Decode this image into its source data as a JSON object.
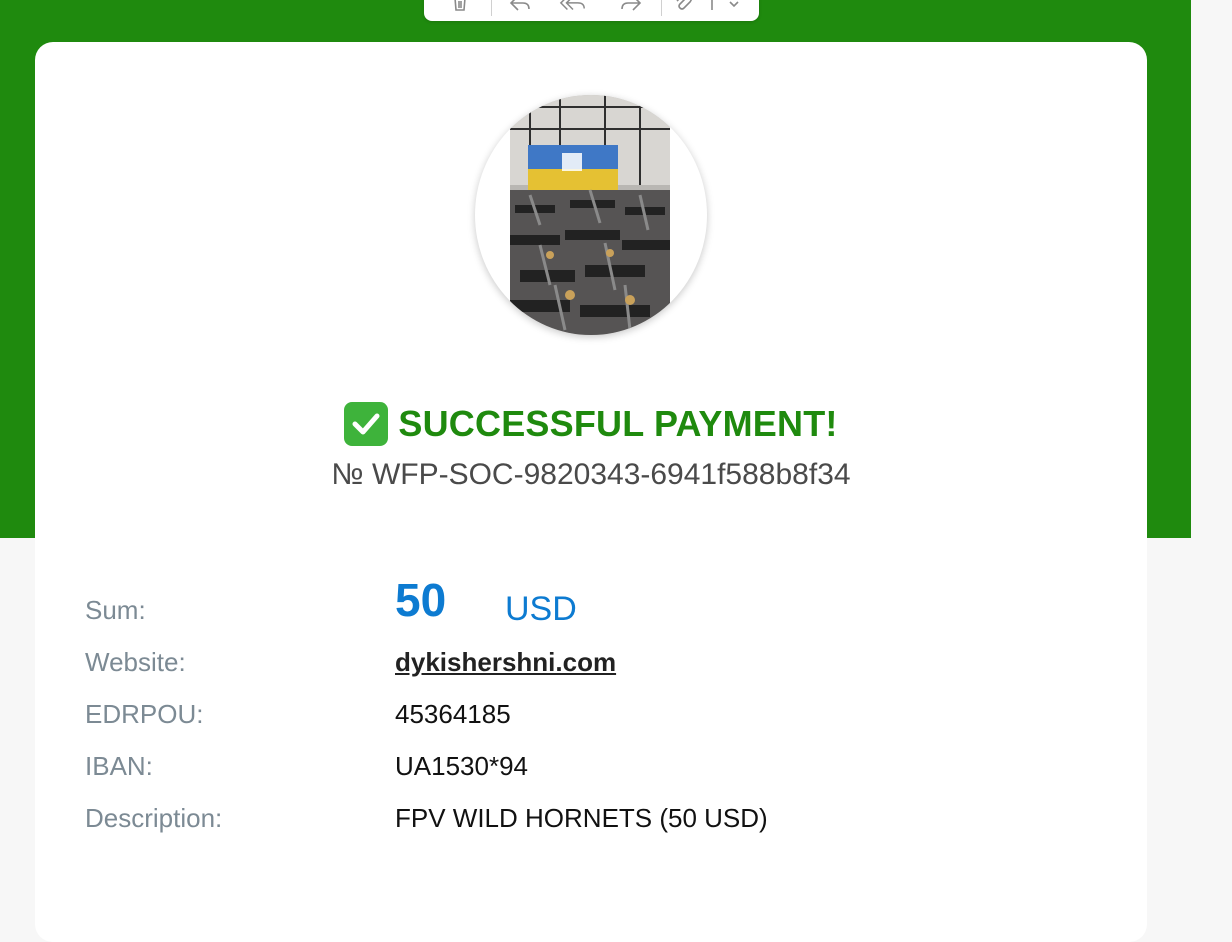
{
  "colors": {
    "brand_green": "#1f8a0e",
    "amount_blue": "#0d7bd1",
    "label_gray": "#7c8a94"
  },
  "toolbar": {
    "items": [
      "trash-icon",
      "reply-icon",
      "reply-all-icon",
      "forward-icon",
      "attachment-icon",
      "more-dropdown-icon"
    ]
  },
  "status": {
    "icon": "check-box-icon",
    "title": "SUCCESSFUL PAYMENT!",
    "number": "№ WFP-SOC-9820343-6941f588b8f34"
  },
  "details": {
    "sum": {
      "label": "Sum:",
      "amount": "50",
      "currency": "USD"
    },
    "website": {
      "label": "Website:",
      "value": "dykishershni.com"
    },
    "edrpou": {
      "label": "EDRPOU:",
      "value": "45364185"
    },
    "iban": {
      "label": "IBAN:",
      "value": "UA1530*94"
    },
    "description": {
      "label": "Description:",
      "value": "FPV WILD HORNETS (50 USD)"
    }
  }
}
